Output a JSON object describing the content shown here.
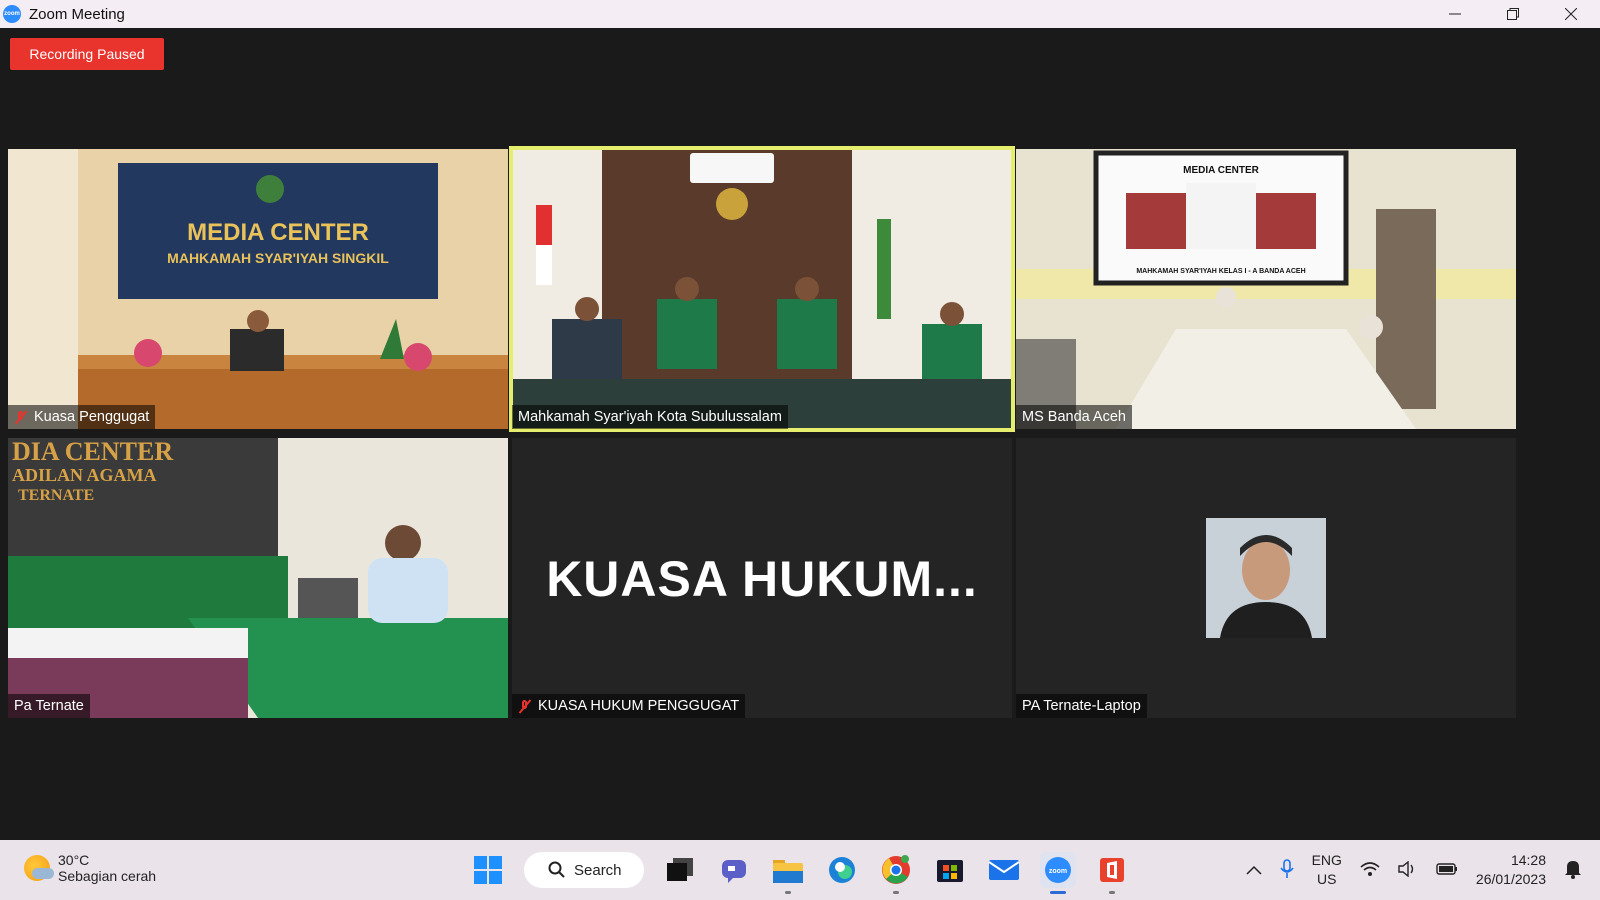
{
  "window": {
    "title": "Zoom Meeting"
  },
  "recording": {
    "label": "Recording Paused"
  },
  "tiles": [
    {
      "name": "Kuasa Penggugat",
      "muted": true
    },
    {
      "name": "Mahkamah Syar'iyah Kota Subulussalam",
      "muted": false,
      "active": true
    },
    {
      "name": "MS Banda Aceh",
      "muted": false
    },
    {
      "name": "Pa Ternate",
      "muted": false
    },
    {
      "name": "KUASA HUKUM PENGGUGAT",
      "muted": true,
      "display_text": "KUASA  HUKUM..."
    },
    {
      "name": "PA Ternate-Laptop",
      "muted": false
    }
  ],
  "scene_text": {
    "tile1_line1": "MEDIA CENTER",
    "tile1_line2": "MAHKAMAH SYAR'IYAH SINGKIL",
    "tile3_line1": "MEDIA CENTER",
    "tile3_line2": "MAHKAMAH SYAR'IYAH KELAS I - A BANDA ACEH",
    "tile4_line1": "DIA CENTER",
    "tile4_line2": "ADILAN AGAMA",
    "tile4_line3": "TERNATE"
  },
  "taskbar": {
    "weather_temp": "30°C",
    "weather_desc": "Sebagian cerah",
    "search_label": "Search",
    "lang_top": "ENG",
    "lang_bottom": "US",
    "time": "14:28",
    "date": "26/01/2023",
    "apps": [
      "windows-start-icon",
      "search",
      "task-view-icon",
      "teams-chat-icon",
      "file-explorer-icon",
      "edge-icon",
      "chrome-icon",
      "store-icon",
      "mail-icon",
      "zoom-icon",
      "office-icon"
    ]
  },
  "colors": {
    "recording": "#e8342d",
    "active_speaker": "#e5ef6d",
    "zoom_blue": "#2d8cff"
  }
}
